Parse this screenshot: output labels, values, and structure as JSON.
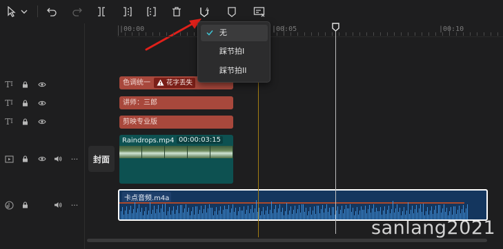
{
  "toolbar": {
    "icons": [
      "select-cursor-icon",
      "chevron-down-icon",
      "undo-icon",
      "redo-icon",
      "split-icon",
      "trim-left-icon",
      "trim-right-icon",
      "delete-icon",
      "auto-beat-icon",
      "marker-icon",
      "freeze-frame-icon"
    ]
  },
  "ruler": {
    "labels": [
      "|00:00",
      "|00:05",
      "|00:10"
    ]
  },
  "beat_menu": {
    "items": [
      {
        "label": "无",
        "selected": true
      },
      {
        "label": "踩节拍I",
        "selected": false
      },
      {
        "label": "踩节拍II",
        "selected": false
      }
    ]
  },
  "tracks": {
    "text1": {
      "label": "色调统一",
      "warning": "花字丢失"
    },
    "text2": {
      "label": "讲师：三郎"
    },
    "text3": {
      "label": "剪映专业版"
    },
    "video": {
      "name": "Raindrops.mp4",
      "duration": "00:00:03:15"
    },
    "cover": {
      "label": "封面"
    },
    "audio": {
      "name": "卡点音频.m4a"
    }
  },
  "watermark": "sanlang2021",
  "colors": {
    "text_clip": "#a8483c",
    "video_clip": "#0d5151",
    "audio_clip": "#14365e",
    "arrow": "#e0201a",
    "marker_line": "#a57f13"
  }
}
